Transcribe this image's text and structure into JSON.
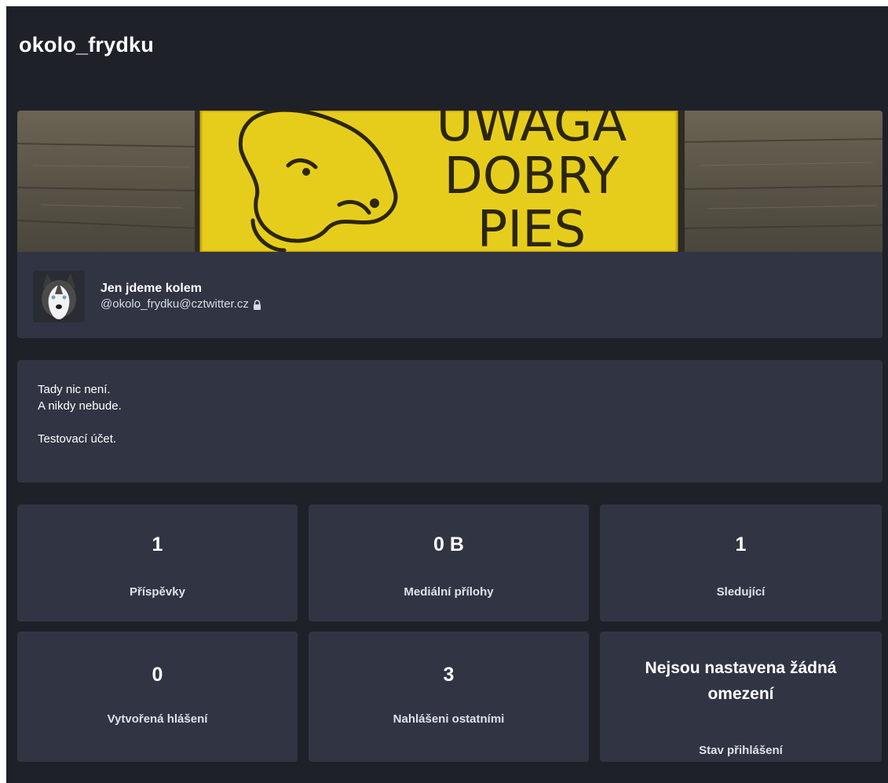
{
  "header": {
    "title": "okolo_frydku"
  },
  "banner": {
    "sign_lines": [
      "UWAGA",
      "DOBRY",
      "PIES"
    ]
  },
  "account": {
    "display_name": "Jen jdeme kolem",
    "handle": "@okolo_frydku@cztwitter.cz",
    "locked_icon": "lock-icon"
  },
  "bio": {
    "line1": "Tady nic není.",
    "line2": "A nikdy nebude.",
    "line3": "Testovací účet."
  },
  "stats": {
    "posts": {
      "value": "1",
      "label": "Příspěvky"
    },
    "media": {
      "value": "0 B",
      "label": "Mediální přílohy"
    },
    "followers": {
      "value": "1",
      "label": "Sledující"
    },
    "reports_created": {
      "value": "0",
      "label": "Vytvořená hlášení"
    },
    "reported_by_others": {
      "value": "3",
      "label": "Nahlášeni ostatními"
    },
    "login_status": {
      "value": "Nejsou nastavena žádná omezení",
      "label": "Stav přihlášení"
    }
  },
  "colors": {
    "background": "#1f2129",
    "card": "#313543",
    "text": "#ffffff",
    "banner_sign": "#e7cd1b"
  }
}
